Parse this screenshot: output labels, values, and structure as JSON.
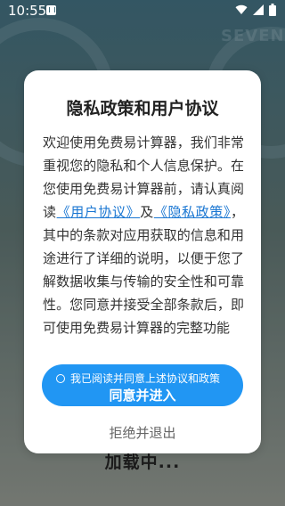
{
  "status_bar": {
    "time": "10:55",
    "icons": [
      "notification-a-icon",
      "wifi-icon",
      "signal-icon",
      "battery-icon"
    ]
  },
  "background": {
    "brand_text": "SEVEN",
    "loading_text": "加载中..."
  },
  "dialog": {
    "title": "隐私政策和用户协议",
    "body": {
      "part1": "欢迎使用免费易计算器，我们非常重视您的隐私和个人信息保护。在您使用免费易计算器前，请认真阅读",
      "link_user_agreement": "《用户协议》",
      "connector": "及",
      "link_privacy_policy": "《隐私政策》",
      "part2": "，其中的条款对应用获取的信息和用途进行了详细的说明，以便于您了解数据收集与传输的安全性和可靠性。您同意并接受全部条款后，即可使用免费易计算器的完整功能"
    },
    "agree_checkbox_label": "我已阅读并同意上述协议和政策",
    "agree_button_label": "同意并进入",
    "reject_button_label": "拒绝并退出"
  },
  "colors": {
    "primary": "#2196f3",
    "link": "#1976d2"
  }
}
